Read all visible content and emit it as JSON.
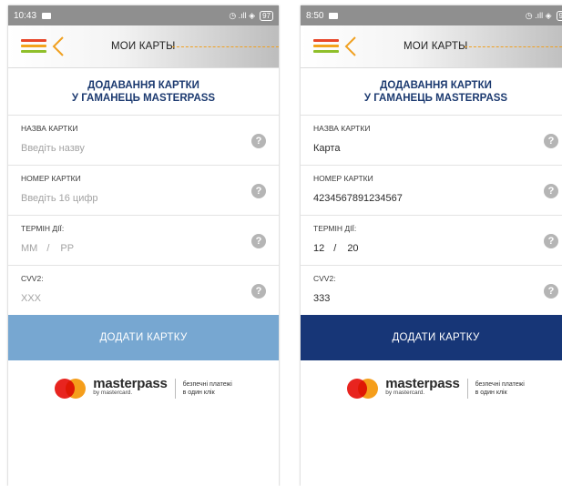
{
  "screens": [
    {
      "statusbar": {
        "time": "10:43",
        "right_icons": "◷ .ıll ◈",
        "battery": "97"
      },
      "appbar": {
        "title": "МОИ КАРТЫ"
      },
      "heading": {
        "line1": "ДОДАВАННЯ КАРТКИ",
        "line2": "У ГАМАНЕЦЬ MASTERPASS"
      },
      "fields": {
        "name": {
          "label": "НАЗВА КАРТКИ",
          "value": "Введіть назву",
          "is_placeholder": true
        },
        "number": {
          "label": "НОМЕР КАРТКИ",
          "value": "Введіть 16 цифр",
          "is_placeholder": true
        },
        "expiry": {
          "label": "ТЕРМІН ДІЇ:",
          "month": "MM",
          "separator": "/",
          "year": "РР",
          "is_placeholder": true
        },
        "cvv": {
          "label": "CVV2:",
          "value": "XXX",
          "is_placeholder": true
        }
      },
      "help_glyph": "?",
      "submit": {
        "label": "ДОДАТИ КАРТКУ",
        "state": "disabled",
        "color": "#77a7d1"
      },
      "footer": {
        "brand": "masterpass",
        "by": "by mastercard.",
        "tagline_1": "безпечні платежі",
        "tagline_2": "в один клік"
      }
    },
    {
      "statusbar": {
        "time": "8:50",
        "right_icons": "◷ .ıll ◈",
        "battery": "9"
      },
      "appbar": {
        "title": "МОИ КАРТЫ"
      },
      "heading": {
        "line1": "ДОДАВАННЯ КАРТКИ",
        "line2": "У ГАМАНЕЦЬ MASTERPASS"
      },
      "fields": {
        "name": {
          "label": "НАЗВА КАРТКИ",
          "value": "Карта",
          "is_placeholder": false
        },
        "number": {
          "label": "НОМЕР КАРТКИ",
          "value": "4234567891234567",
          "is_placeholder": false
        },
        "expiry": {
          "label": "ТЕРМІН ДІЇ:",
          "month": "12",
          "separator": "/",
          "year": "20",
          "is_placeholder": false
        },
        "cvv": {
          "label": "CVV2:",
          "value": "333",
          "is_placeholder": false
        }
      },
      "help_glyph": "?",
      "submit": {
        "label": "ДОДАТИ КАРТКУ",
        "state": "enabled",
        "color": "#173677"
      },
      "footer": {
        "brand": "masterpass",
        "by": "by mastercard.",
        "tagline_1": "безпечні платежі",
        "tagline_2": "в один клік"
      }
    }
  ],
  "colors": {
    "accent_orange": "#f0a020",
    "heading_blue": "#1c3a70",
    "menu_red": "#e8472a",
    "menu_orange": "#f3a31c",
    "menu_green": "#8fbf2a",
    "mc_red": "#e8241f",
    "mc_orange": "#f59e1b"
  },
  "icons": [
    "hamburger-menu-icon",
    "back-chevron-icon",
    "help-question-icon",
    "masterpass-logo"
  ]
}
